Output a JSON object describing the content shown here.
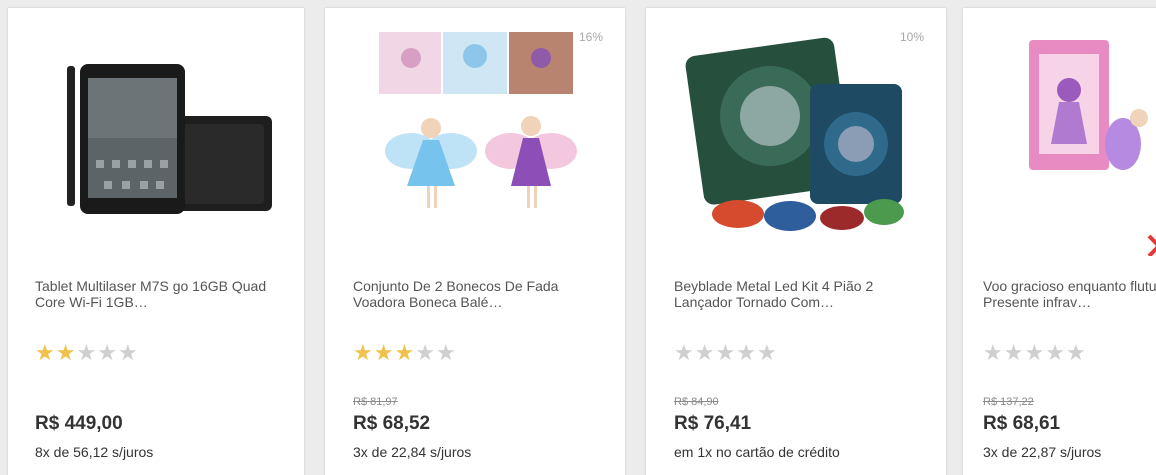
{
  "products": [
    {
      "title": "Tablet Multilaser M7S go 16GB Quad Core Wi-Fi 1GB…",
      "rating": 2,
      "discount": "",
      "old_price": "",
      "price": "R$ 449,00",
      "installments": "8x de 56,12 s/juros",
      "image_icon": "tablet-image"
    },
    {
      "title": "Conjunto De 2 Bonecos De Fada Voadora Boneca Balé…",
      "rating": 3,
      "discount": "16%",
      "old_price": "R$ 81,97",
      "price": "R$ 68,52",
      "installments": "3x de 22,84 s/juros",
      "image_icon": "fairy-dolls-image"
    },
    {
      "title": "Beyblade Metal Led Kit 4 Pião 2 Lançador Tornado Com…",
      "rating": 0,
      "discount": "10%",
      "old_price": "R$ 84,90",
      "price": "R$ 76,41",
      "installments": "em 1x no cartão de crédito",
      "image_icon": "beyblade-kit-image"
    },
    {
      "title": "Voo gracioso enquanto flutua Presente infrav…",
      "rating": 0,
      "discount": "",
      "old_price": "R$ 137,22",
      "price": "R$ 68,61",
      "installments": "3x de 22,87 s/juros",
      "image_icon": "fairy-doll-box-image"
    }
  ],
  "colors": {
    "star_on": "#f0c24c",
    "star_off": "#cfcfcf",
    "background": "#ececec"
  }
}
